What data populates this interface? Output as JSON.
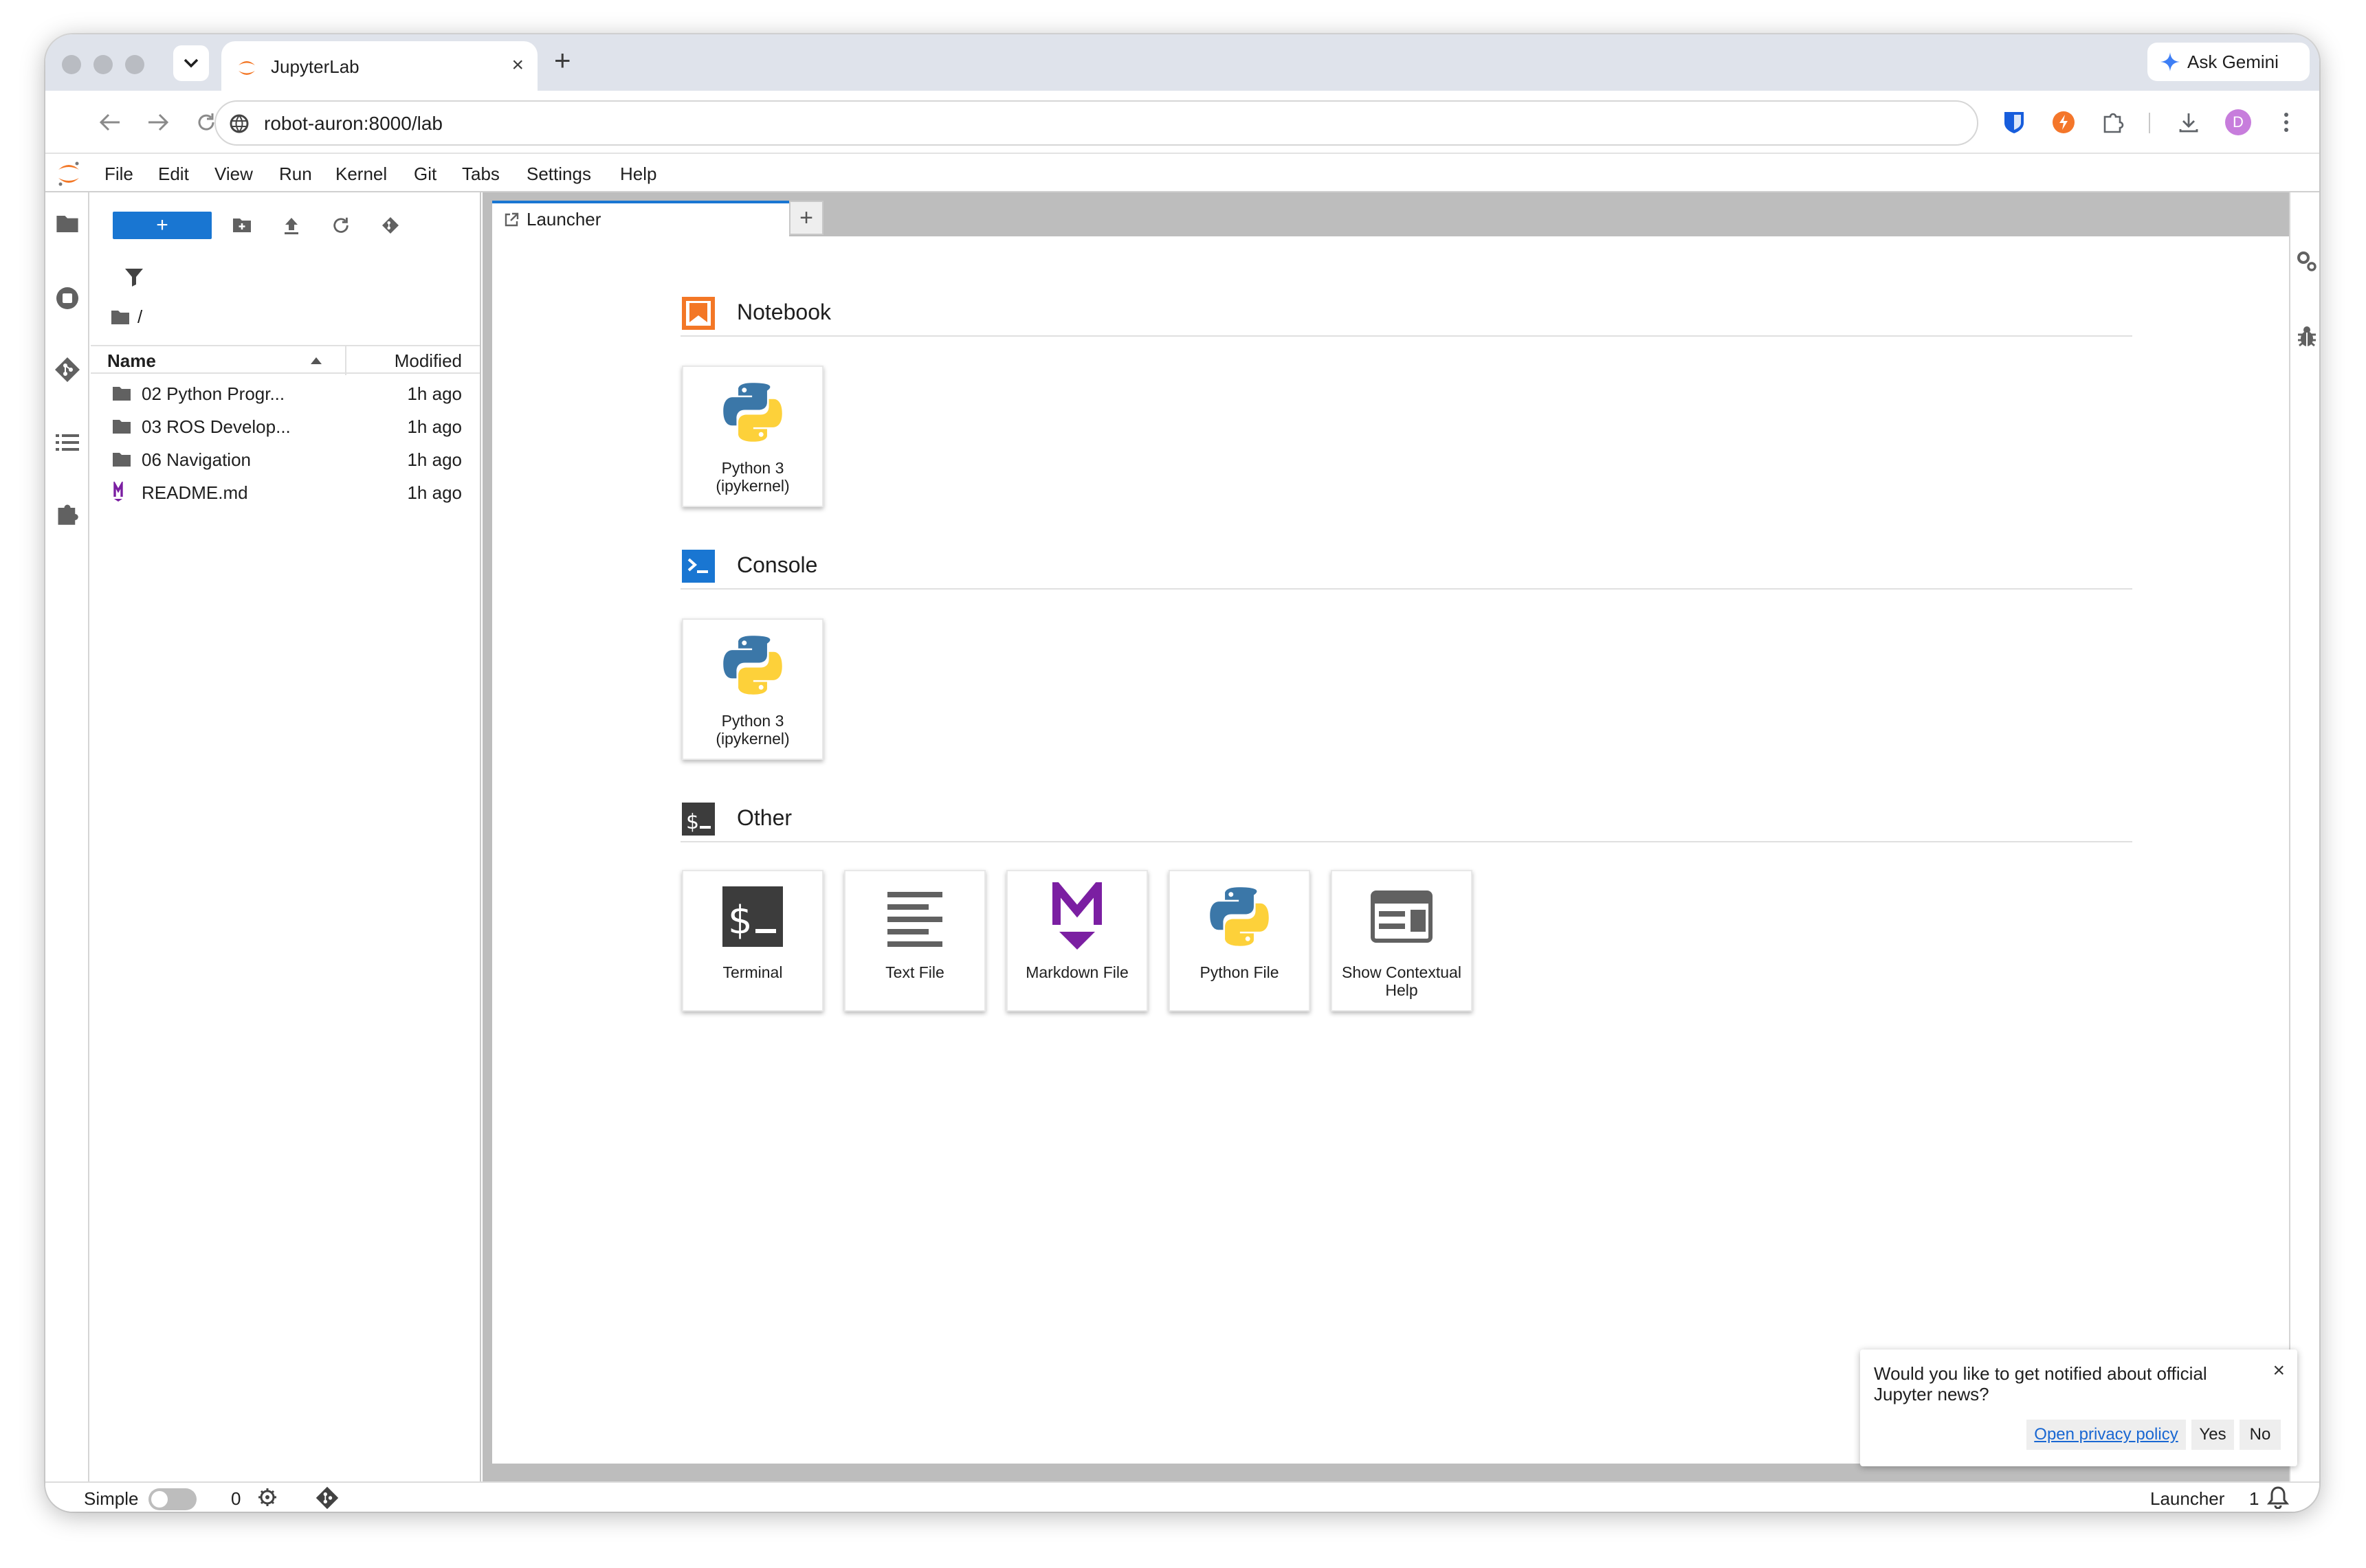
{
  "browser": {
    "tab_title": "JupyterLab",
    "new_tab_symbol": "+",
    "close_symbol": "×",
    "url": "robot-auron:8000/lab",
    "gemini_label": "Ask Gemini",
    "profile_initial": "D"
  },
  "menu": [
    "File",
    "Edit",
    "View",
    "Run",
    "Kernel",
    "Git",
    "Tabs",
    "Settings",
    "Help"
  ],
  "filebrowser": {
    "new_button": "+",
    "breadcrumb": "/",
    "columns": {
      "name": "Name",
      "modified": "Modified"
    },
    "files": [
      {
        "name": "02 Python Progr...",
        "modified": "1h ago",
        "type": "folder"
      },
      {
        "name": "03 ROS Develop...",
        "modified": "1h ago",
        "type": "folder"
      },
      {
        "name": "06 Navigation",
        "modified": "1h ago",
        "type": "folder"
      },
      {
        "name": "README.md",
        "modified": "1h ago",
        "type": "markdown"
      }
    ]
  },
  "dock": {
    "tab_label": "Launcher",
    "add_symbol": "+"
  },
  "launcher": {
    "sections": [
      {
        "title": "Notebook",
        "icon": "notebook-icon",
        "cards": [
          {
            "label": "Python 3 (ipykernel)",
            "icon": "python-icon"
          }
        ]
      },
      {
        "title": "Console",
        "icon": "console-icon",
        "cards": [
          {
            "label": "Python 3 (ipykernel)",
            "icon": "python-icon"
          }
        ]
      },
      {
        "title": "Other",
        "icon": "other-icon",
        "cards": [
          {
            "label": "Terminal",
            "icon": "terminal-icon"
          },
          {
            "label": "Text File",
            "icon": "text-file-icon"
          },
          {
            "label": "Markdown File",
            "icon": "markdown-icon"
          },
          {
            "label": "Python File",
            "icon": "python-icon"
          },
          {
            "label": "Show Contextual Help",
            "icon": "contextual-help-icon"
          }
        ]
      }
    ]
  },
  "notification": {
    "message": "Would you like to get notified about official Jupyter news?",
    "privacy_link": "Open privacy policy",
    "yes": "Yes",
    "no": "No",
    "close_symbol": "×"
  },
  "statusbar": {
    "mode_label": "Simple",
    "kernel_count": "0",
    "right_label": "Launcher",
    "notification_count": "1"
  },
  "colors": {
    "accent": "#1976d2",
    "jupyter_orange": "#f37726",
    "markdown_purple": "#7b1fa2"
  }
}
